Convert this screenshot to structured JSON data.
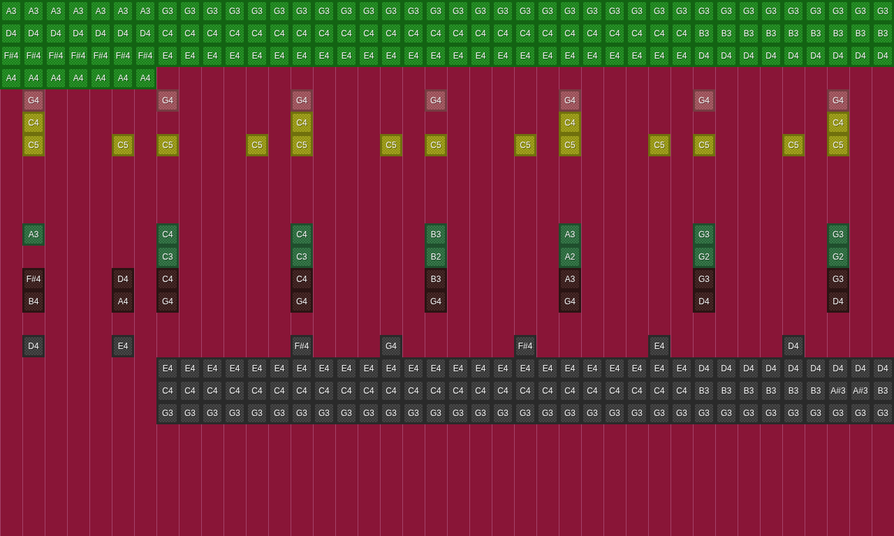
{
  "rows": [
    {
      "color": "#1b8a1b",
      "notes": [
        {
          "kind": "note",
          "note": "A3"
        },
        {
          "kind": "note",
          "note": "A3"
        },
        {
          "kind": "note",
          "note": "A3"
        },
        {
          "kind": "note",
          "note": "A3"
        },
        {
          "kind": "note",
          "note": "A3"
        },
        {
          "kind": "note",
          "note": "A3"
        },
        {
          "kind": "note",
          "note": "A3"
        },
        {
          "kind": "note",
          "note": "G3"
        },
        {
          "kind": "note",
          "note": "G3"
        },
        {
          "kind": "note",
          "note": "G3"
        },
        {
          "kind": "note",
          "note": "G3"
        },
        {
          "kind": "note",
          "note": "G3"
        },
        {
          "kind": "note",
          "note": "G3"
        },
        {
          "kind": "note",
          "note": "G3"
        },
        {
          "kind": "note",
          "note": "G3"
        },
        {
          "kind": "note",
          "note": "G3"
        },
        {
          "kind": "note",
          "note": "G3"
        },
        {
          "kind": "note",
          "note": "G3"
        },
        {
          "kind": "note",
          "note": "G3"
        },
        {
          "kind": "note",
          "note": "G3"
        },
        {
          "kind": "note",
          "note": "G3"
        },
        {
          "kind": "note",
          "note": "G3"
        },
        {
          "kind": "note",
          "note": "G3"
        },
        {
          "kind": "note",
          "note": "G3"
        },
        {
          "kind": "note",
          "note": "G3"
        },
        {
          "kind": "note",
          "note": "G3"
        },
        {
          "kind": "note",
          "note": "G3"
        },
        {
          "kind": "note",
          "note": "G3"
        },
        {
          "kind": "note",
          "note": "G3"
        },
        {
          "kind": "note",
          "note": "G3"
        },
        {
          "kind": "note",
          "note": "G3"
        },
        {
          "kind": "note",
          "note": "G3"
        },
        {
          "kind": "note",
          "note": "G3"
        },
        {
          "kind": "note",
          "note": "G3"
        },
        {
          "kind": "note",
          "note": "G3"
        },
        {
          "kind": "note",
          "note": "G3"
        },
        {
          "kind": "note",
          "note": "G3"
        },
        {
          "kind": "note",
          "note": "G3"
        },
        {
          "kind": "note",
          "note": "G3"
        },
        {
          "kind": "note",
          "note": "G3"
        }
      ]
    },
    {
      "color": "#1b8a1b",
      "notes": [
        {
          "kind": "note",
          "note": "D4"
        },
        {
          "kind": "note",
          "note": "D4"
        },
        {
          "kind": "note",
          "note": "D4"
        },
        {
          "kind": "note",
          "note": "D4"
        },
        {
          "kind": "note",
          "note": "D4"
        },
        {
          "kind": "note",
          "note": "D4"
        },
        {
          "kind": "note",
          "note": "D4"
        },
        {
          "kind": "note",
          "note": "C4"
        },
        {
          "kind": "note",
          "note": "C4"
        },
        {
          "kind": "note",
          "note": "C4"
        },
        {
          "kind": "note",
          "note": "C4"
        },
        {
          "kind": "note",
          "note": "C4"
        },
        {
          "kind": "note",
          "note": "C4"
        },
        {
          "kind": "note",
          "note": "C4"
        },
        {
          "kind": "note",
          "note": "C4"
        },
        {
          "kind": "note",
          "note": "C4"
        },
        {
          "kind": "note",
          "note": "C4"
        },
        {
          "kind": "note",
          "note": "C4"
        },
        {
          "kind": "note",
          "note": "C4"
        },
        {
          "kind": "note",
          "note": "C4"
        },
        {
          "kind": "note",
          "note": "C4"
        },
        {
          "kind": "note",
          "note": "C4"
        },
        {
          "kind": "note",
          "note": "C4"
        },
        {
          "kind": "note",
          "note": "C4"
        },
        {
          "kind": "note",
          "note": "C4"
        },
        {
          "kind": "note",
          "note": "C4"
        },
        {
          "kind": "note",
          "note": "C4"
        },
        {
          "kind": "note",
          "note": "C4"
        },
        {
          "kind": "note",
          "note": "C4"
        },
        {
          "kind": "note",
          "note": "C4"
        },
        {
          "kind": "note",
          "note": "C4"
        },
        {
          "kind": "note",
          "note": "B3"
        },
        {
          "kind": "note",
          "note": "B3"
        },
        {
          "kind": "note",
          "note": "B3"
        },
        {
          "kind": "note",
          "note": "B3"
        },
        {
          "kind": "note",
          "note": "B3"
        },
        {
          "kind": "note",
          "note": "B3"
        },
        {
          "kind": "note",
          "note": "B3"
        },
        {
          "kind": "note",
          "note": "B3"
        },
        {
          "kind": "note",
          "note": "B3"
        }
      ]
    },
    {
      "color": "#1b8a1b",
      "notes": [
        {
          "kind": "note",
          "note": "F#4"
        },
        {
          "kind": "note",
          "note": "F#4"
        },
        {
          "kind": "note",
          "note": "F#4"
        },
        {
          "kind": "note",
          "note": "F#4"
        },
        {
          "kind": "note",
          "note": "F#4"
        },
        {
          "kind": "note",
          "note": "F#4"
        },
        {
          "kind": "note",
          "note": "F#4"
        },
        {
          "kind": "note",
          "note": "E4"
        },
        {
          "kind": "note",
          "note": "E4"
        },
        {
          "kind": "note",
          "note": "E4"
        },
        {
          "kind": "note",
          "note": "E4"
        },
        {
          "kind": "note",
          "note": "E4"
        },
        {
          "kind": "note",
          "note": "E4"
        },
        {
          "kind": "note",
          "note": "E4"
        },
        {
          "kind": "note",
          "note": "E4"
        },
        {
          "kind": "note",
          "note": "E4"
        },
        {
          "kind": "note",
          "note": "E4"
        },
        {
          "kind": "note",
          "note": "E4"
        },
        {
          "kind": "note",
          "note": "E4"
        },
        {
          "kind": "note",
          "note": "E4"
        },
        {
          "kind": "note",
          "note": "E4"
        },
        {
          "kind": "note",
          "note": "E4"
        },
        {
          "kind": "note",
          "note": "E4"
        },
        {
          "kind": "note",
          "note": "E4"
        },
        {
          "kind": "note",
          "note": "E4"
        },
        {
          "kind": "note",
          "note": "E4"
        },
        {
          "kind": "note",
          "note": "E4"
        },
        {
          "kind": "note",
          "note": "E4"
        },
        {
          "kind": "note",
          "note": "E4"
        },
        {
          "kind": "note",
          "note": "E4"
        },
        {
          "kind": "note",
          "note": "E4"
        },
        {
          "kind": "note",
          "note": "D4"
        },
        {
          "kind": "note",
          "note": "D4"
        },
        {
          "kind": "note",
          "note": "D4"
        },
        {
          "kind": "note",
          "note": "D4"
        },
        {
          "kind": "note",
          "note": "D4"
        },
        {
          "kind": "note",
          "note": "D4"
        },
        {
          "kind": "note",
          "note": "D4"
        },
        {
          "kind": "note",
          "note": "D4"
        },
        {
          "kind": "note",
          "note": "D4"
        }
      ]
    },
    {
      "color": "#1b8a1b",
      "notes": [
        {
          "kind": "note",
          "note": "A4"
        },
        {
          "kind": "note",
          "note": "A4"
        },
        {
          "kind": "note",
          "note": "A4"
        },
        {
          "kind": "note",
          "note": "A4"
        },
        {
          "kind": "note",
          "note": "A4"
        },
        {
          "kind": "note",
          "note": "A4"
        },
        {
          "kind": "note",
          "note": "A4"
        }
      ]
    },
    {
      "color": "#a3545c",
      "notes": [
        {
          "kind": "rest"
        },
        {
          "kind": "note",
          "note": "G4"
        },
        {
          "kind": "rest"
        },
        {
          "kind": "rest"
        },
        {
          "kind": "rest"
        },
        {
          "kind": "rest"
        },
        {
          "kind": "rest"
        },
        {
          "kind": "note",
          "note": "G4"
        },
        {
          "kind": "rest"
        },
        {
          "kind": "rest"
        },
        {
          "kind": "rest"
        },
        {
          "kind": "rest"
        },
        {
          "kind": "rest"
        },
        {
          "kind": "note",
          "note": "G4"
        },
        {
          "kind": "rest"
        },
        {
          "kind": "rest"
        },
        {
          "kind": "rest"
        },
        {
          "kind": "rest"
        },
        {
          "kind": "rest"
        },
        {
          "kind": "note",
          "note": "G4"
        },
        {
          "kind": "rest"
        },
        {
          "kind": "rest"
        },
        {
          "kind": "rest"
        },
        {
          "kind": "rest"
        },
        {
          "kind": "rest"
        },
        {
          "kind": "note",
          "note": "G4"
        },
        {
          "kind": "rest"
        },
        {
          "kind": "rest"
        },
        {
          "kind": "rest"
        },
        {
          "kind": "rest"
        },
        {
          "kind": "rest"
        },
        {
          "kind": "note",
          "note": "G4"
        },
        {
          "kind": "rest"
        },
        {
          "kind": "rest"
        },
        {
          "kind": "rest"
        },
        {
          "kind": "rest"
        },
        {
          "kind": "rest"
        },
        {
          "kind": "note",
          "note": "G4"
        }
      ]
    },
    {
      "color": "#9c9c12",
      "notes": [
        {
          "kind": "rest"
        },
        {
          "kind": "note",
          "note": "C4"
        },
        {
          "kind": "rest"
        },
        {
          "kind": "rest"
        },
        {
          "kind": "rest"
        },
        {
          "kind": "rest"
        },
        {
          "kind": "rest"
        },
        {
          "kind": "rest"
        },
        {
          "kind": "rest"
        },
        {
          "kind": "rest"
        },
        {
          "kind": "rest"
        },
        {
          "kind": "rest"
        },
        {
          "kind": "rest"
        },
        {
          "kind": "note",
          "note": "C4"
        },
        {
          "kind": "rest"
        },
        {
          "kind": "rest"
        },
        {
          "kind": "rest"
        },
        {
          "kind": "rest"
        },
        {
          "kind": "rest"
        },
        {
          "kind": "rest"
        },
        {
          "kind": "rest"
        },
        {
          "kind": "rest"
        },
        {
          "kind": "rest"
        },
        {
          "kind": "rest"
        },
        {
          "kind": "rest"
        },
        {
          "kind": "note",
          "note": "C4"
        },
        {
          "kind": "rest"
        },
        {
          "kind": "rest"
        },
        {
          "kind": "rest"
        },
        {
          "kind": "rest"
        },
        {
          "kind": "rest"
        },
        {
          "kind": "rest"
        },
        {
          "kind": "rest"
        },
        {
          "kind": "rest"
        },
        {
          "kind": "rest"
        },
        {
          "kind": "rest"
        },
        {
          "kind": "rest"
        },
        {
          "kind": "note",
          "note": "C4"
        }
      ]
    },
    {
      "color": "#9c9c12",
      "notes": [
        {
          "kind": "rest"
        },
        {
          "kind": "note",
          "note": "C5"
        },
        {
          "kind": "rest"
        },
        {
          "kind": "rest"
        },
        {
          "kind": "rest"
        },
        {
          "kind": "note",
          "note": "C5"
        },
        {
          "kind": "rest"
        },
        {
          "kind": "note",
          "note": "C5"
        },
        {
          "kind": "rest"
        },
        {
          "kind": "rest"
        },
        {
          "kind": "rest"
        },
        {
          "kind": "note",
          "note": "C5"
        },
        {
          "kind": "rest"
        },
        {
          "kind": "note",
          "note": "C5"
        },
        {
          "kind": "rest"
        },
        {
          "kind": "rest"
        },
        {
          "kind": "rest"
        },
        {
          "kind": "note",
          "note": "C5"
        },
        {
          "kind": "rest"
        },
        {
          "kind": "note",
          "note": "C5"
        },
        {
          "kind": "rest"
        },
        {
          "kind": "rest"
        },
        {
          "kind": "rest"
        },
        {
          "kind": "note",
          "note": "C5"
        },
        {
          "kind": "rest"
        },
        {
          "kind": "note",
          "note": "C5"
        },
        {
          "kind": "rest"
        },
        {
          "kind": "rest"
        },
        {
          "kind": "rest"
        },
        {
          "kind": "note",
          "note": "C5"
        },
        {
          "kind": "rest"
        },
        {
          "kind": "note",
          "note": "C5"
        },
        {
          "kind": "rest"
        },
        {
          "kind": "rest"
        },
        {
          "kind": "rest"
        },
        {
          "kind": "note",
          "note": "C5"
        },
        {
          "kind": "rest"
        },
        {
          "kind": "note",
          "note": "C5"
        }
      ]
    },
    null,
    null,
    null,
    {
      "color": "#2b6e3e",
      "notes": [
        {
          "kind": "rest"
        },
        {
          "kind": "note",
          "note": "A3"
        },
        {
          "kind": "rest"
        },
        {
          "kind": "rest"
        },
        {
          "kind": "rest"
        },
        {
          "kind": "rest"
        },
        {
          "kind": "rest"
        },
        {
          "kind": "note",
          "note": "C4"
        },
        {
          "kind": "rest"
        },
        {
          "kind": "rest"
        },
        {
          "kind": "rest"
        },
        {
          "kind": "rest"
        },
        {
          "kind": "rest"
        },
        {
          "kind": "note",
          "note": "C4"
        },
        {
          "kind": "rest"
        },
        {
          "kind": "rest"
        },
        {
          "kind": "rest"
        },
        {
          "kind": "rest"
        },
        {
          "kind": "rest"
        },
        {
          "kind": "note",
          "note": "B3"
        },
        {
          "kind": "rest"
        },
        {
          "kind": "rest"
        },
        {
          "kind": "rest"
        },
        {
          "kind": "rest"
        },
        {
          "kind": "rest"
        },
        {
          "kind": "note",
          "note": "A3"
        },
        {
          "kind": "rest"
        },
        {
          "kind": "rest"
        },
        {
          "kind": "rest"
        },
        {
          "kind": "rest"
        },
        {
          "kind": "rest"
        },
        {
          "kind": "note",
          "note": "G3"
        },
        {
          "kind": "rest"
        },
        {
          "kind": "rest"
        },
        {
          "kind": "rest"
        },
        {
          "kind": "rest"
        },
        {
          "kind": "rest"
        },
        {
          "kind": "note",
          "note": "G3"
        }
      ]
    },
    {
      "color": "#2b6e3e",
      "notes": [
        {
          "kind": "rest"
        },
        {
          "kind": "rest"
        },
        {
          "kind": "rest"
        },
        {
          "kind": "rest"
        },
        {
          "kind": "rest"
        },
        {
          "kind": "rest"
        },
        {
          "kind": "rest"
        },
        {
          "kind": "note",
          "note": "C3"
        },
        {
          "kind": "rest"
        },
        {
          "kind": "rest"
        },
        {
          "kind": "rest"
        },
        {
          "kind": "rest"
        },
        {
          "kind": "rest"
        },
        {
          "kind": "note",
          "note": "C3"
        },
        {
          "kind": "rest"
        },
        {
          "kind": "rest"
        },
        {
          "kind": "rest"
        },
        {
          "kind": "rest"
        },
        {
          "kind": "rest"
        },
        {
          "kind": "note",
          "note": "B2"
        },
        {
          "kind": "rest"
        },
        {
          "kind": "rest"
        },
        {
          "kind": "rest"
        },
        {
          "kind": "rest"
        },
        {
          "kind": "rest"
        },
        {
          "kind": "note",
          "note": "A2"
        },
        {
          "kind": "rest"
        },
        {
          "kind": "rest"
        },
        {
          "kind": "rest"
        },
        {
          "kind": "rest"
        },
        {
          "kind": "rest"
        },
        {
          "kind": "note",
          "note": "G2"
        },
        {
          "kind": "rest"
        },
        {
          "kind": "rest"
        },
        {
          "kind": "rest"
        },
        {
          "kind": "rest"
        },
        {
          "kind": "rest"
        },
        {
          "kind": "note",
          "note": "G2"
        }
      ]
    },
    {
      "color": "#3a1c1a",
      "notes": [
        {
          "kind": "rest"
        },
        {
          "kind": "note",
          "note": "F#4"
        },
        {
          "kind": "rest"
        },
        {
          "kind": "rest"
        },
        {
          "kind": "rest"
        },
        {
          "kind": "note",
          "note": "D4"
        },
        {
          "kind": "rest"
        },
        {
          "kind": "note",
          "note": "C4"
        },
        {
          "kind": "rest"
        },
        {
          "kind": "rest"
        },
        {
          "kind": "rest"
        },
        {
          "kind": "rest"
        },
        {
          "kind": "rest"
        },
        {
          "kind": "note",
          "note": "C4"
        },
        {
          "kind": "rest"
        },
        {
          "kind": "rest"
        },
        {
          "kind": "rest"
        },
        {
          "kind": "rest"
        },
        {
          "kind": "rest"
        },
        {
          "kind": "note",
          "note": "B3"
        },
        {
          "kind": "rest"
        },
        {
          "kind": "rest"
        },
        {
          "kind": "rest"
        },
        {
          "kind": "rest"
        },
        {
          "kind": "rest"
        },
        {
          "kind": "note",
          "note": "A3"
        },
        {
          "kind": "rest"
        },
        {
          "kind": "rest"
        },
        {
          "kind": "rest"
        },
        {
          "kind": "rest"
        },
        {
          "kind": "rest"
        },
        {
          "kind": "note",
          "note": "G3"
        },
        {
          "kind": "rest"
        },
        {
          "kind": "rest"
        },
        {
          "kind": "rest"
        },
        {
          "kind": "rest"
        },
        {
          "kind": "rest"
        },
        {
          "kind": "note",
          "note": "G3"
        }
      ]
    },
    {
      "color": "#3a1c1a",
      "notes": [
        {
          "kind": "rest"
        },
        {
          "kind": "note",
          "note": "B4"
        },
        {
          "kind": "rest"
        },
        {
          "kind": "rest"
        },
        {
          "kind": "rest"
        },
        {
          "kind": "note",
          "note": "A4"
        },
        {
          "kind": "rest"
        },
        {
          "kind": "note",
          "note": "G4"
        },
        {
          "kind": "rest"
        },
        {
          "kind": "rest"
        },
        {
          "kind": "rest"
        },
        {
          "kind": "rest"
        },
        {
          "kind": "rest"
        },
        {
          "kind": "note",
          "note": "G4"
        },
        {
          "kind": "rest"
        },
        {
          "kind": "rest"
        },
        {
          "kind": "rest"
        },
        {
          "kind": "rest"
        },
        {
          "kind": "rest"
        },
        {
          "kind": "note",
          "note": "G4"
        },
        {
          "kind": "rest"
        },
        {
          "kind": "rest"
        },
        {
          "kind": "rest"
        },
        {
          "kind": "rest"
        },
        {
          "kind": "rest"
        },
        {
          "kind": "note",
          "note": "G4"
        },
        {
          "kind": "rest"
        },
        {
          "kind": "rest"
        },
        {
          "kind": "rest"
        },
        {
          "kind": "rest"
        },
        {
          "kind": "rest"
        },
        {
          "kind": "note",
          "note": "D4"
        },
        {
          "kind": "rest"
        },
        {
          "kind": "rest"
        },
        {
          "kind": "rest"
        },
        {
          "kind": "rest"
        },
        {
          "kind": "rest"
        },
        {
          "kind": "note",
          "note": "D4"
        }
      ]
    },
    null,
    {
      "color": "#3a3a3a",
      "notes": [
        {
          "kind": "rest"
        },
        {
          "kind": "note",
          "note": "D4"
        },
        {
          "kind": "rest"
        },
        {
          "kind": "rest"
        },
        {
          "kind": "rest"
        },
        {
          "kind": "note",
          "note": "E4"
        },
        {
          "kind": "rest"
        },
        {
          "kind": "rest"
        },
        {
          "kind": "rest"
        },
        {
          "kind": "rest"
        },
        {
          "kind": "rest"
        },
        {
          "kind": "rest"
        },
        {
          "kind": "rest"
        },
        {
          "kind": "note",
          "note": "F#4"
        },
        {
          "kind": "rest"
        },
        {
          "kind": "rest"
        },
        {
          "kind": "rest"
        },
        {
          "kind": "note",
          "note": "G4"
        },
        {
          "kind": "rest"
        },
        {
          "kind": "rest"
        },
        {
          "kind": "rest"
        },
        {
          "kind": "rest"
        },
        {
          "kind": "rest"
        },
        {
          "kind": "note",
          "note": "F#4"
        },
        {
          "kind": "rest"
        },
        {
          "kind": "rest"
        },
        {
          "kind": "rest"
        },
        {
          "kind": "rest"
        },
        {
          "kind": "rest"
        },
        {
          "kind": "note",
          "note": "E4"
        },
        {
          "kind": "rest"
        },
        {
          "kind": "rest"
        },
        {
          "kind": "rest"
        },
        {
          "kind": "rest"
        },
        {
          "kind": "rest"
        },
        {
          "kind": "note",
          "note": "D4"
        }
      ]
    },
    {
      "color": "#3a3a3a",
      "notes": [
        {
          "kind": "rest"
        },
        {
          "kind": "rest"
        },
        {
          "kind": "rest"
        },
        {
          "kind": "rest"
        },
        {
          "kind": "rest"
        },
        {
          "kind": "rest"
        },
        {
          "kind": "rest"
        },
        {
          "kind": "note",
          "note": "E4"
        },
        {
          "kind": "note",
          "note": "E4"
        },
        {
          "kind": "note",
          "note": "E4"
        },
        {
          "kind": "note",
          "note": "E4"
        },
        {
          "kind": "note",
          "note": "E4"
        },
        {
          "kind": "note",
          "note": "E4"
        },
        {
          "kind": "note",
          "note": "E4"
        },
        {
          "kind": "note",
          "note": "E4"
        },
        {
          "kind": "note",
          "note": "E4"
        },
        {
          "kind": "note",
          "note": "E4"
        },
        {
          "kind": "note",
          "note": "E4"
        },
        {
          "kind": "note",
          "note": "E4"
        },
        {
          "kind": "note",
          "note": "E4"
        },
        {
          "kind": "note",
          "note": "E4"
        },
        {
          "kind": "note",
          "note": "E4"
        },
        {
          "kind": "note",
          "note": "E4"
        },
        {
          "kind": "note",
          "note": "E4"
        },
        {
          "kind": "note",
          "note": "E4"
        },
        {
          "kind": "note",
          "note": "E4"
        },
        {
          "kind": "note",
          "note": "E4"
        },
        {
          "kind": "note",
          "note": "E4"
        },
        {
          "kind": "note",
          "note": "E4"
        },
        {
          "kind": "note",
          "note": "E4"
        },
        {
          "kind": "note",
          "note": "E4"
        },
        {
          "kind": "note",
          "note": "D4"
        },
        {
          "kind": "note",
          "note": "D4"
        },
        {
          "kind": "note",
          "note": "D4"
        },
        {
          "kind": "note",
          "note": "D4"
        },
        {
          "kind": "note",
          "note": "D4"
        },
        {
          "kind": "note",
          "note": "D4"
        },
        {
          "kind": "note",
          "note": "D4"
        },
        {
          "kind": "note",
          "note": "D4"
        },
        {
          "kind": "note",
          "note": "D4"
        }
      ]
    },
    {
      "color": "#3a3a3a",
      "notes": [
        {
          "kind": "rest"
        },
        {
          "kind": "rest"
        },
        {
          "kind": "rest"
        },
        {
          "kind": "rest"
        },
        {
          "kind": "rest"
        },
        {
          "kind": "rest"
        },
        {
          "kind": "rest"
        },
        {
          "kind": "note",
          "note": "C4"
        },
        {
          "kind": "note",
          "note": "C4"
        },
        {
          "kind": "note",
          "note": "C4"
        },
        {
          "kind": "note",
          "note": "C4"
        },
        {
          "kind": "note",
          "note": "C4"
        },
        {
          "kind": "note",
          "note": "C4"
        },
        {
          "kind": "note",
          "note": "C4"
        },
        {
          "kind": "note",
          "note": "C4"
        },
        {
          "kind": "note",
          "note": "C4"
        },
        {
          "kind": "note",
          "note": "C4"
        },
        {
          "kind": "note",
          "note": "C4"
        },
        {
          "kind": "note",
          "note": "C4"
        },
        {
          "kind": "note",
          "note": "C4"
        },
        {
          "kind": "note",
          "note": "C4"
        },
        {
          "kind": "note",
          "note": "C4"
        },
        {
          "kind": "note",
          "note": "C4"
        },
        {
          "kind": "note",
          "note": "C4"
        },
        {
          "kind": "note",
          "note": "C4"
        },
        {
          "kind": "note",
          "note": "C4"
        },
        {
          "kind": "note",
          "note": "C4"
        },
        {
          "kind": "note",
          "note": "C4"
        },
        {
          "kind": "note",
          "note": "C4"
        },
        {
          "kind": "note",
          "note": "C4"
        },
        {
          "kind": "note",
          "note": "C4"
        },
        {
          "kind": "note",
          "note": "B3"
        },
        {
          "kind": "note",
          "note": "B3"
        },
        {
          "kind": "note",
          "note": "B3"
        },
        {
          "kind": "note",
          "note": "B3"
        },
        {
          "kind": "note",
          "note": "B3"
        },
        {
          "kind": "note",
          "note": "B3"
        },
        {
          "kind": "note",
          "note": "A#3"
        },
        {
          "kind": "note",
          "note": "A#3"
        },
        {
          "kind": "note",
          "note": "B3"
        }
      ]
    },
    {
      "color": "#3a3a3a",
      "notes": [
        {
          "kind": "rest"
        },
        {
          "kind": "rest"
        },
        {
          "kind": "rest"
        },
        {
          "kind": "rest"
        },
        {
          "kind": "rest"
        },
        {
          "kind": "rest"
        },
        {
          "kind": "rest"
        },
        {
          "kind": "note",
          "note": "G3"
        },
        {
          "kind": "note",
          "note": "G3"
        },
        {
          "kind": "note",
          "note": "G3"
        },
        {
          "kind": "note",
          "note": "G3"
        },
        {
          "kind": "note",
          "note": "G3"
        },
        {
          "kind": "note",
          "note": "G3"
        },
        {
          "kind": "note",
          "note": "G3"
        },
        {
          "kind": "note",
          "note": "G3"
        },
        {
          "kind": "note",
          "note": "G3"
        },
        {
          "kind": "note",
          "note": "G3"
        },
        {
          "kind": "note",
          "note": "G3"
        },
        {
          "kind": "note",
          "note": "G3"
        },
        {
          "kind": "note",
          "note": "G3"
        },
        {
          "kind": "note",
          "note": "G3"
        },
        {
          "kind": "note",
          "note": "G3"
        },
        {
          "kind": "note",
          "note": "G3"
        },
        {
          "kind": "note",
          "note": "G3"
        },
        {
          "kind": "note",
          "note": "G3"
        },
        {
          "kind": "note",
          "note": "G3"
        },
        {
          "kind": "note",
          "note": "G3"
        },
        {
          "kind": "note",
          "note": "G3"
        },
        {
          "kind": "note",
          "note": "G3"
        },
        {
          "kind": "note",
          "note": "G3"
        },
        {
          "kind": "note",
          "note": "G3"
        },
        {
          "kind": "note",
          "note": "G3"
        },
        {
          "kind": "note",
          "note": "G3"
        },
        {
          "kind": "note",
          "note": "G3"
        },
        {
          "kind": "note",
          "note": "G3"
        },
        {
          "kind": "note",
          "note": "G3"
        },
        {
          "kind": "note",
          "note": "G3"
        },
        {
          "kind": "note",
          "note": "G3"
        },
        {
          "kind": "note",
          "note": "G3"
        },
        {
          "kind": "note",
          "note": "G3"
        }
      ]
    }
  ]
}
